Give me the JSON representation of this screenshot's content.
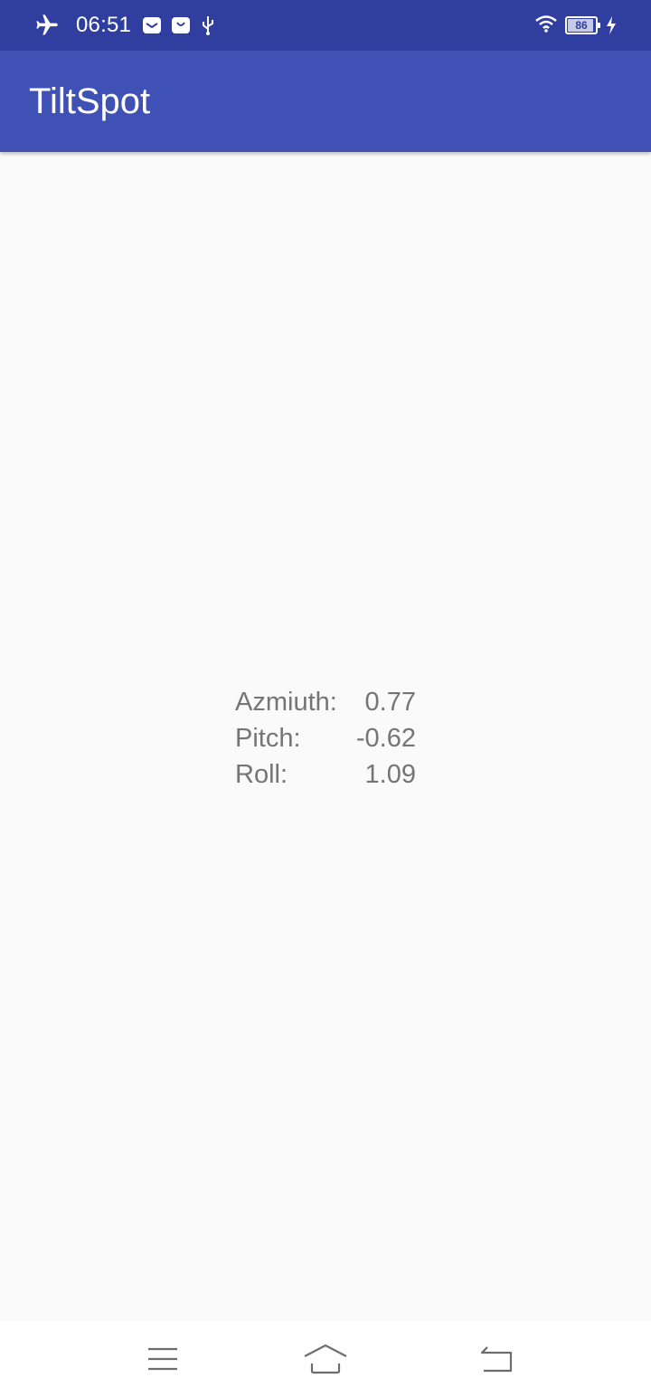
{
  "status_bar": {
    "time": "06:51",
    "battery_level": "86",
    "icons": {
      "left": [
        "airplane-mode-icon",
        "mail-notification-icon",
        "store-notification-icon",
        "usb-icon"
      ],
      "right": [
        "wifi-icon",
        "battery-icon",
        "charging-icon"
      ]
    },
    "background_color": "#303f9f"
  },
  "app_bar": {
    "title": "TiltSpot",
    "background_color": "#3f51b5"
  },
  "readouts": {
    "azimuth": {
      "label": "Azmiuth:",
      "value": "0.77"
    },
    "pitch": {
      "label": "Pitch:",
      "value": "-0.62"
    },
    "roll": {
      "label": "Roll:",
      "value": "1.09"
    }
  },
  "nav_bar": {
    "buttons": [
      "menu-icon",
      "home-icon",
      "back-icon"
    ]
  }
}
